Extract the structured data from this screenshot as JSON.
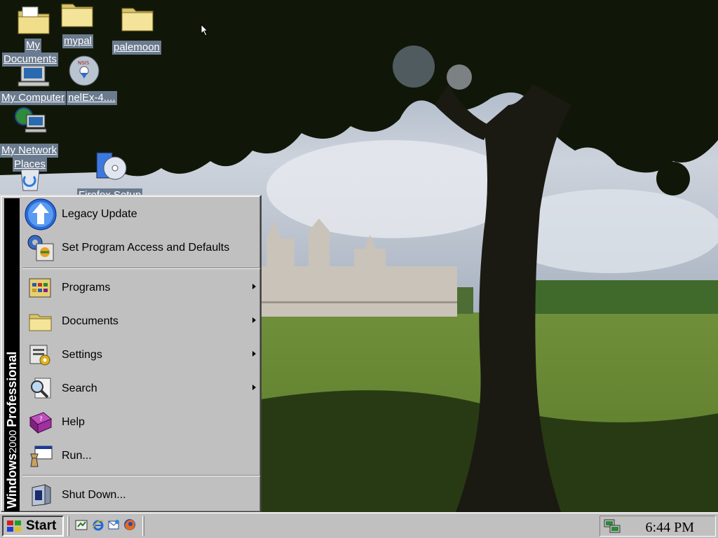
{
  "desktop_icons": [
    {
      "id": "my-documents",
      "label_line1": "My",
      "label_line2": "Documents"
    },
    {
      "id": "mypal",
      "label": "mypal"
    },
    {
      "id": "palemoon",
      "label": "palemoon"
    },
    {
      "id": "my-computer",
      "label": "My Computer"
    },
    {
      "id": "kernelex",
      "label": "nelEx-4...."
    },
    {
      "id": "my-network-places",
      "label_line1": "My Network",
      "label_line2": "Places"
    },
    {
      "id": "firefox-setup",
      "label": "Firefox Setup"
    }
  ],
  "start_menu": {
    "banner_brand": "Windows",
    "banner_version": "2000",
    "banner_edition": "Professional",
    "items": [
      {
        "label": "Legacy Update",
        "icon": "legacy-update-icon",
        "submenu": false
      },
      {
        "label": "Set Program Access and Defaults",
        "icon": "program-defaults-icon",
        "submenu": false
      },
      {
        "label": "Programs",
        "icon": "programs-icon",
        "submenu": true
      },
      {
        "label": "Documents",
        "icon": "documents-icon",
        "submenu": true
      },
      {
        "label": "Settings",
        "icon": "settings-icon",
        "submenu": true
      },
      {
        "label": "Search",
        "icon": "search-icon",
        "submenu": true
      },
      {
        "label": "Help",
        "icon": "help-icon",
        "submenu": false
      },
      {
        "label": "Run...",
        "icon": "run-icon",
        "submenu": false
      },
      {
        "label": "Shut Down...",
        "icon": "shutdown-icon",
        "submenu": false
      }
    ]
  },
  "taskbar": {
    "start_label": "Start",
    "quick_launch": [
      "show-desktop-icon",
      "internet-explorer-icon",
      "outlook-express-icon",
      "firefox-icon"
    ],
    "clock": "6:44 PM"
  },
  "colors": {
    "desktop_label_bg": "#6b7b8f",
    "face": "#c0c0c0",
    "banner": "#000000",
    "banner_edition": "#1a3fd0"
  }
}
